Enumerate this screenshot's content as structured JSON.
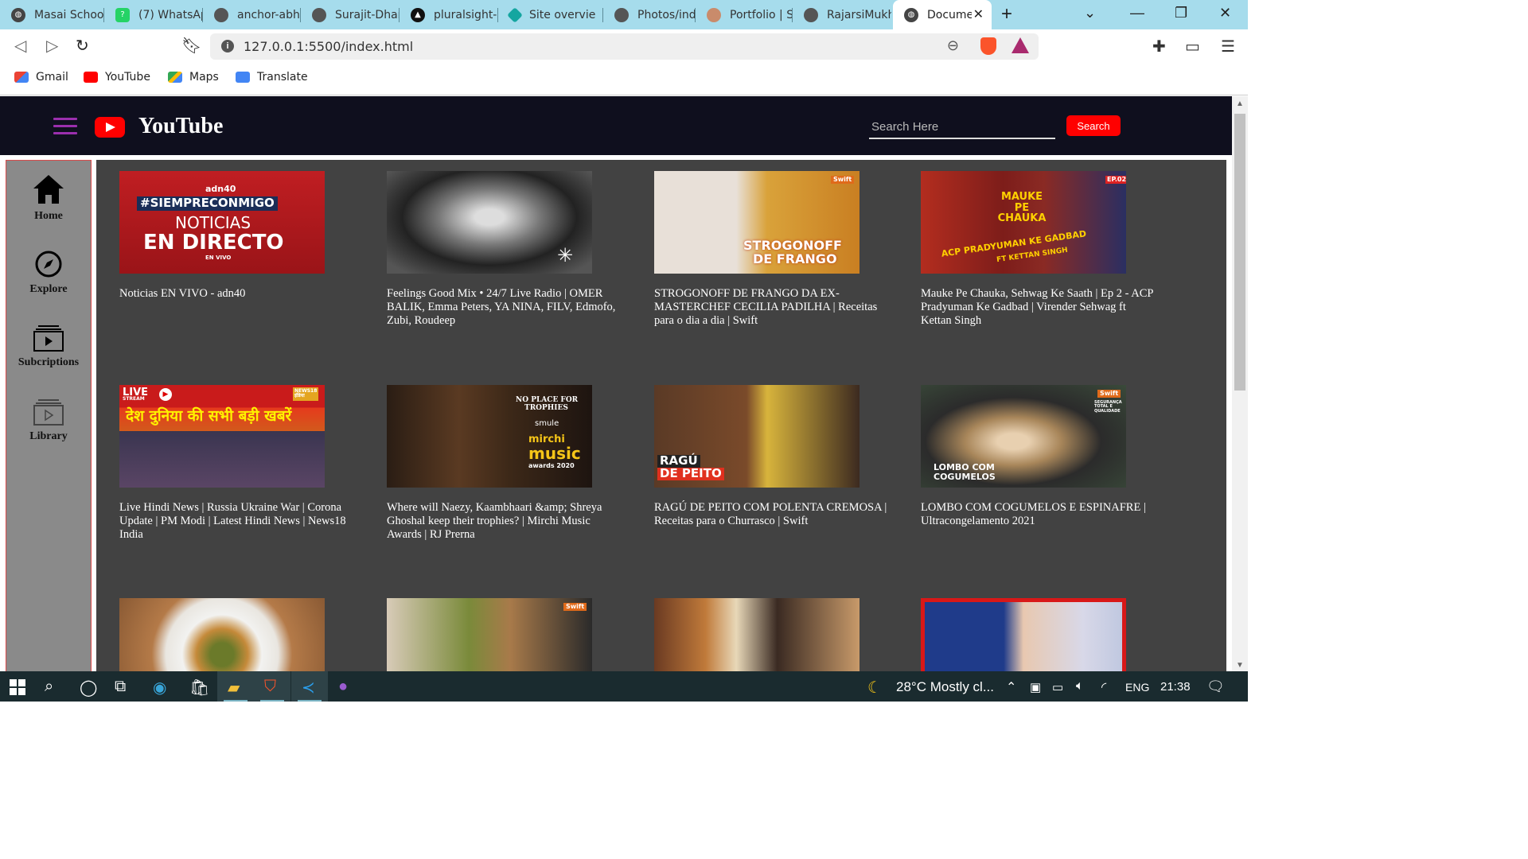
{
  "browser": {
    "tabs": [
      {
        "title": "Masai Schoo",
        "favicon": "globe-icon"
      },
      {
        "title": "(7) WhatsAp",
        "favicon": "whatsapp-icon"
      },
      {
        "title": "anchor-abhi",
        "favicon": "github-icon"
      },
      {
        "title": "Surajit-Dhar",
        "favicon": "github-icon"
      },
      {
        "title": "pluralsight-",
        "favicon": "pluralsight-icon"
      },
      {
        "title": "Site overvie",
        "favicon": "netlify-icon"
      },
      {
        "title": "Photos/inde",
        "favicon": "github-icon"
      },
      {
        "title": "Portfolio | S",
        "favicon": "portfolio-icon"
      },
      {
        "title": "RajarsiMukh",
        "favicon": "github-icon"
      },
      {
        "title": "Docume",
        "favicon": "globe-icon",
        "active": true
      }
    ],
    "url": "127.0.0.1:5500/index.html",
    "bookmarks": [
      {
        "label": "Gmail",
        "icon": "gmail-icon"
      },
      {
        "label": "YouTube",
        "icon": "youtube-icon"
      },
      {
        "label": "Maps",
        "icon": "maps-icon"
      },
      {
        "label": "Translate",
        "icon": "translate-icon"
      }
    ]
  },
  "header": {
    "title": "YouTube",
    "search_placeholder": "Search Here",
    "search_button": "Search"
  },
  "sidebar": {
    "items": [
      {
        "label": "Home",
        "icon": "home-icon"
      },
      {
        "label": "Explore",
        "icon": "compass-icon"
      },
      {
        "label": "Subcriptions",
        "icon": "subscriptions-icon"
      },
      {
        "label": "Library",
        "icon": "library-icon"
      }
    ]
  },
  "videos": [
    {
      "title": "Noticias EN VIVO - adn40",
      "thumb_text": [
        "adn40",
        "#SIEMPRECONMIGO",
        "NOTICIAS",
        "EN DIRECTO",
        "EN VIVO"
      ]
    },
    {
      "title": "Feelings Good Mix • 24/7 Live Radio | OMER BALIK, Emma Peters, YA NINA, FILV, Edmofo, Zubi, Roudeep"
    },
    {
      "title": "STROGONOFF DE FRANGO DA EX-MASTERCHEF CECILIA PADILHA | Receitas para o dia a dia | Swift",
      "thumb_text": [
        "Swift",
        "STROGONOFF",
        "DE FRANGO"
      ]
    },
    {
      "title": "Mauke Pe Chauka, Sehwag Ke Saath | Ep 2 - ACP Pradyuman Ke Gadbad | Virender Sehwag ft Kettan Singh",
      "thumb_text": [
        "EP.02",
        "MAUKE PE CHAUKA",
        "ACP PRADYUMAN KE GADBAD",
        "FT KETTAN SINGH"
      ]
    },
    {
      "title": "Live Hindi News | Russia Ukraine War | Corona Update | PM Modi | Latest Hindi News | News18 India",
      "thumb_text": [
        "LIVE",
        "STREAM",
        "NEWS18 इंडिया",
        "देश दुनिया की सभी बड़ी खबरें"
      ]
    },
    {
      "title": "Where will Naezy, Kaambhaari &amp; Shreya Ghoshal keep their trophies? | Mirchi Music Awards | RJ Prerna",
      "thumb_text": [
        "NO PLACE FOR",
        "TROPHIES",
        "smule",
        "mirchi",
        "music",
        "awards 2020"
      ]
    },
    {
      "title": "RAGÚ DE PEITO COM POLENTA CREMOSA | Receitas para o Churrasco | Swift",
      "thumb_text": [
        "RAGÚ",
        "DE PEITO"
      ]
    },
    {
      "title": "LOMBO COM COGUMELOS E ESPINAFRE | Ultracongelamento 2021",
      "thumb_text": [
        "Swift",
        "SEGURANÇA TOTAL E QUALIDADE",
        "LOMBO COM",
        "COGUMELOS"
      ]
    },
    {
      "title": ""
    },
    {
      "title": "",
      "thumb_text": [
        "Swift"
      ]
    },
    {
      "title": ""
    },
    {
      "title": ""
    }
  ],
  "taskbar": {
    "weather": "28°C  Mostly cl...",
    "language": "ENG",
    "time": "21:38"
  },
  "colors": {
    "header_bg": "#0f0f1e",
    "main_bg": "#424242",
    "sidebar_bg": "#8a8a8a",
    "accent_red": "#ff0000",
    "hamburger": "#9b2fae",
    "tab_strip": "#a6dcec"
  }
}
